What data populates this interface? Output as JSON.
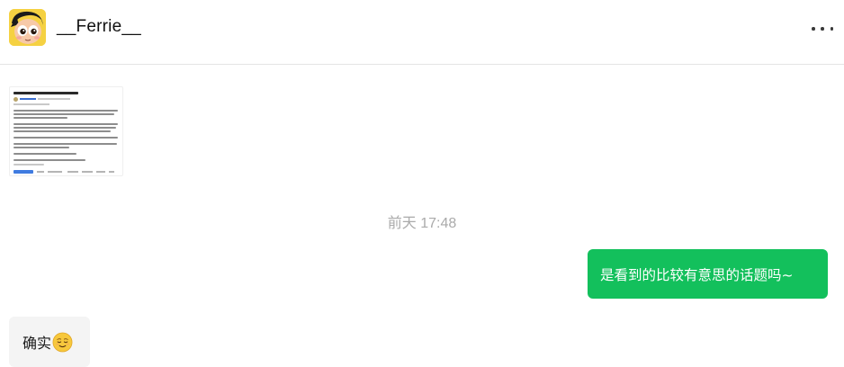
{
  "header": {
    "contact_name": "__Ferrie__"
  },
  "messages": {
    "timestamp": "前天 17:48",
    "outgoing_text": "是看到的比较有意思的话题吗~",
    "incoming_text": "确实",
    "incoming_emoji": "relieved-face-icon"
  },
  "colors": {
    "outgoing_bubble": "#13c05c",
    "incoming_bubble": "#f4f4f4",
    "timestamp_text": "#aaaaaa"
  }
}
